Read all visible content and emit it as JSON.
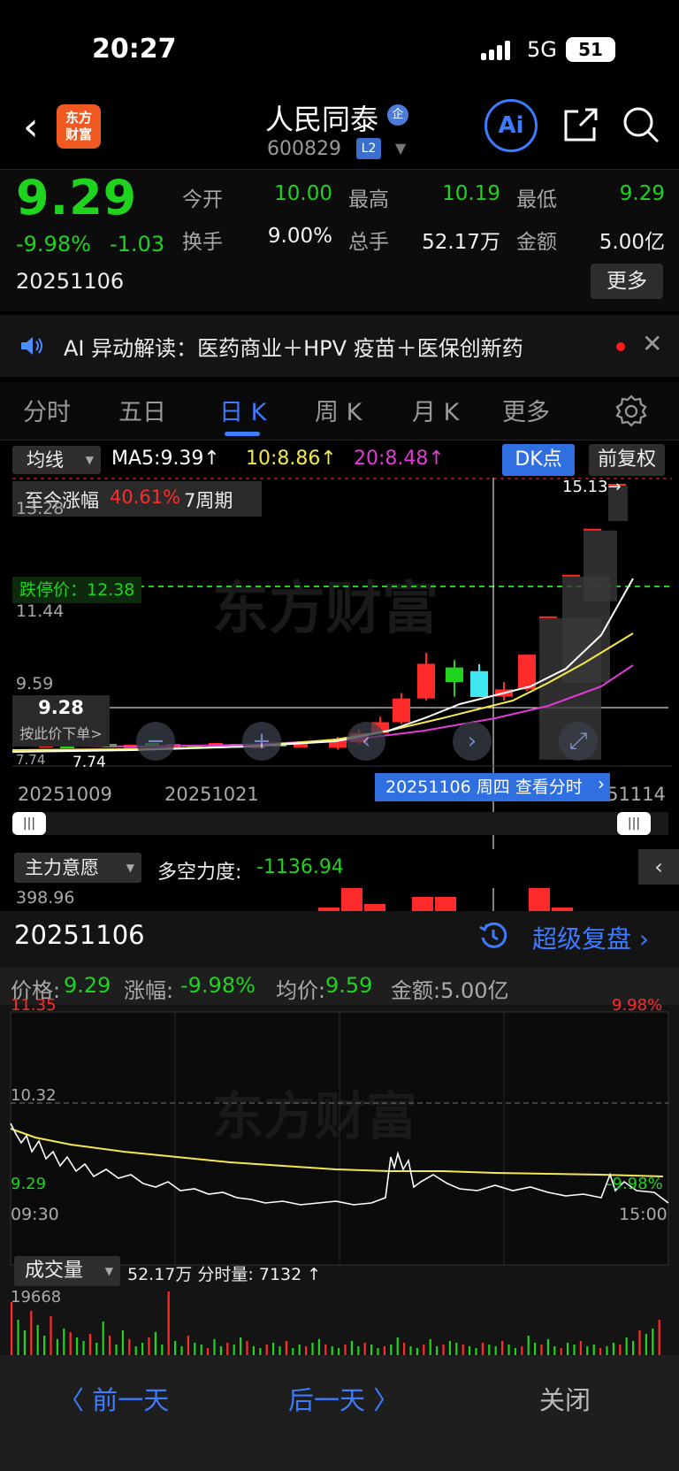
{
  "status_bar": {
    "time": "20:27",
    "network": "5G",
    "battery": "51"
  },
  "header": {
    "logo_line1": "东方",
    "logo_line2": "财富",
    "stock_name": "人民同泰",
    "corp_badge": "企",
    "stock_code": "600829",
    "level_badge": "L2",
    "ai_label": "Ai"
  },
  "quote": {
    "price": "9.29",
    "change_pct": "-9.98%",
    "change_amt": "-1.03",
    "date": "20251106",
    "stats": [
      {
        "label": "今开",
        "value": "10.00",
        "color": "#1fd31f"
      },
      {
        "label": "最高",
        "value": "10.19",
        "color": "#1fd31f"
      },
      {
        "label": "最低",
        "value": "9.29",
        "color": "#1fd31f"
      },
      {
        "label": "换手",
        "value": "9.00%",
        "color": "#f2f2f2"
      },
      {
        "label": "总手",
        "value": "52.17万",
        "color": "#f2f2f2"
      },
      {
        "label": "金额",
        "value": "5.00亿",
        "color": "#f2f2f2"
      }
    ],
    "more_label": "更多"
  },
  "ai_bar": {
    "text": "AI 异动解读：医药商业＋HPV 疫苗＋医保创新药"
  },
  "tabs": [
    "分时",
    "五日",
    "日 K",
    "周 K",
    "月 K",
    "更多"
  ],
  "active_tab": 2,
  "ma_row": {
    "select_label": "均线",
    "ma5": "MA5:9.39↑",
    "ma10": "10:8.86↑",
    "ma20": "20:8.48↑",
    "dk_label": "DK点",
    "fq_label": "前复权"
  },
  "kchart": {
    "period_label": "至今涨幅",
    "period_value": "40.61%",
    "period_n": "7周期",
    "y_ticks": [
      "13.28",
      "11.44",
      "9.59",
      "7.74"
    ],
    "limit_label": "跌停价：12.38",
    "crosshair_price": "9.28",
    "crosshair_order": "按此价下单>",
    "max_label": "15.13→",
    "min_label": "7.74",
    "x_dates": [
      "20251009",
      "20251021",
      "20251114"
    ],
    "date_tip": "20251106 周四 查看分时",
    "colors": {
      "up": "#ff2b2b",
      "down": "#1fd31f",
      "ma5": "#ffffff",
      "ma10": "#f5e84a",
      "ma20": "#e23ad6",
      "selected": "#3fe7f0"
    }
  },
  "indicator": {
    "select_label": "主力意愿",
    "label": "多空力度:",
    "value": "-1136.94",
    "y_top": "398.96"
  },
  "replay": {
    "date": "20251106",
    "link": "超级复盘",
    "info_label_price": "价格:",
    "info_price": "9.29",
    "info_label_chg": "涨幅:",
    "info_chg": "-9.98%",
    "info_label_avg": "均价:",
    "info_avg": "9.59",
    "info_amount": "金额:5.00亿",
    "y_top": "11.35",
    "y_mid": "10.32",
    "y_bot": "9.29",
    "pct_top": "9.98%",
    "pct_bot": "-9.98%",
    "t_start": "09:30",
    "t_end": "15:00",
    "vol_select": "成交量",
    "vol_text": "52.17万 分时量: 7132 ↑",
    "vol_max": "19668"
  },
  "bottom_nav": {
    "prev": "〈 前一天",
    "next": "后一天 〉",
    "close": "关闭"
  },
  "chart_data": {
    "type": "candlestick",
    "series": [
      {
        "name": "MA5",
        "values": []
      },
      {
        "name": "10",
        "values": []
      },
      {
        "name": "20",
        "values": []
      }
    ],
    "candles_recent": [
      {
        "open": 7.9,
        "close": 8.1,
        "high": 8.2,
        "low": 7.85
      },
      {
        "open": 8.05,
        "close": 8.3,
        "high": 8.4,
        "low": 8.0
      },
      {
        "open": 8.3,
        "close": 8.6,
        "high": 8.75,
        "low": 8.25
      },
      {
        "open": 8.6,
        "close": 9.25,
        "high": 9.4,
        "low": 8.55
      },
      {
        "open": 9.25,
        "close": 10.2,
        "high": 10.5,
        "low": 9.2
      },
      {
        "open": 10.1,
        "close": 9.7,
        "high": 10.3,
        "low": 9.3
      },
      {
        "open": 10.0,
        "close": 9.29,
        "high": 10.19,
        "low": 9.29
      },
      {
        "open": 9.3,
        "close": 9.5,
        "high": 9.7,
        "low": 9.2
      },
      {
        "open": 9.5,
        "close": 10.45,
        "high": 10.45,
        "low": 9.45
      },
      {
        "open": 11.5,
        "close": 11.5,
        "high": 11.5,
        "low": 11.5
      },
      {
        "open": 12.64,
        "close": 12.64,
        "high": 12.64,
        "low": 12.64
      },
      {
        "open": 13.9,
        "close": 13.9,
        "high": 13.9,
        "low": 13.9
      },
      {
        "open": 15.13,
        "close": 15.13,
        "high": 15.13,
        "low": 15.13
      }
    ],
    "y_range": [
      7.4,
      15.3
    ]
  }
}
